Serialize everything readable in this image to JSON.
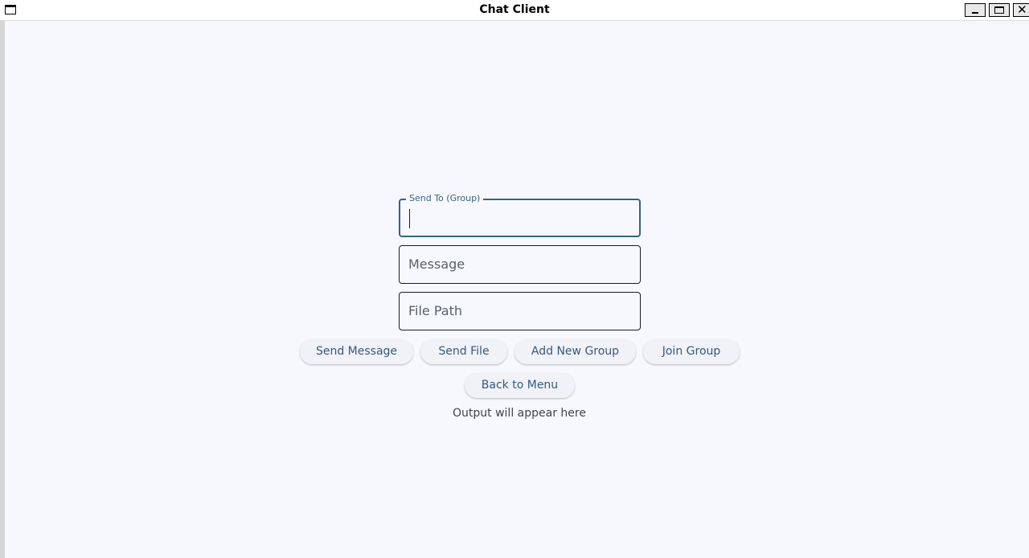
{
  "window": {
    "title": "Chat Client",
    "controls": [
      "minimize",
      "maximize",
      "close"
    ],
    "close_glyph": "✕"
  },
  "form": {
    "send_to": {
      "label": "Send To (Group)",
      "value": ""
    },
    "message": {
      "placeholder": "Message",
      "value": ""
    },
    "file_path": {
      "placeholder": "File Path",
      "value": ""
    }
  },
  "buttons": {
    "send_message": "Send Message",
    "send_file": "Send File",
    "add_new_group": "Add New Group",
    "join_group": "Join Group",
    "back_to_menu": "Back to Menu"
  },
  "output": {
    "text": "Output will appear here"
  },
  "colors": {
    "background": "#f7f8fd",
    "accent": "#39627f",
    "button_text": "#36597a"
  }
}
